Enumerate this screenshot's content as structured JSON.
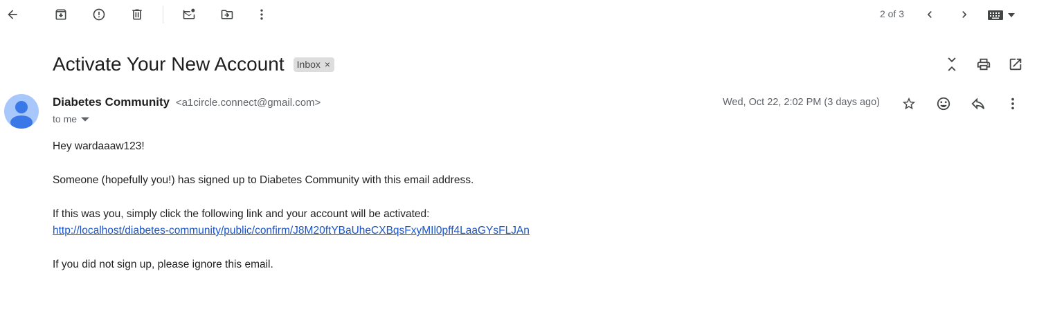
{
  "toolbar": {
    "back_icon": "arrow-left-icon",
    "archive_icon": "archive-icon",
    "spam_icon": "report-spam-icon",
    "delete_icon": "trash-icon",
    "mark_unread_icon": "mark-unread-icon",
    "move_icon": "move-to-icon",
    "more_icon": "more-vertical-icon",
    "pager": "2 of 3",
    "prev_icon": "chevron-left-icon",
    "next_icon": "chevron-right-icon",
    "keyboard_icon": "keyboard-icon"
  },
  "subject": {
    "title": "Activate Your New Account",
    "label": "Inbox",
    "label_close": "×"
  },
  "message": {
    "sender_name": "Diabetes Community",
    "sender_email": "<a1circle.connect@gmail.com>",
    "recipient": "to me",
    "date": "Wed, Oct 22, 2:02 PM (3 days ago)",
    "body": {
      "greeting": "Hey wardaaaw123!",
      "line1": "Someone (hopefully you!) has signed up to Diabetes Community with this email address.",
      "line2": "If this was you, simply click the following link and your account will be activated:",
      "link": "http://localhost/diabetes-community/public/confirm/J8M20ftYBaUheCXBqsFxyMIl0pff4LaaGYsFLJAn",
      "line3": "If you did not sign up, please ignore this email."
    }
  },
  "colors": {
    "link": "#1a55c8",
    "avatar_bg": "#a8c7fa",
    "avatar_fg": "#3b78e7",
    "chip_bg": "#dddddd"
  }
}
